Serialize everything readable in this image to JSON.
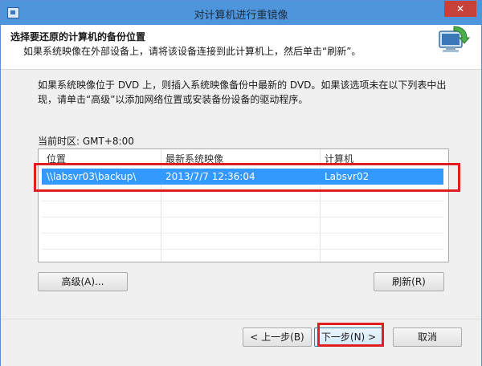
{
  "window": {
    "title": "对计算机进行重镜像",
    "close_glyph": "✕"
  },
  "header": {
    "title": "选择要还原的计算机的备份位置",
    "subtitle": "如果系统映像在外部设备上，请将该设备连接到此计算机上，然后单击“刷新”。",
    "icon": "computer-restore-icon"
  },
  "description": "如果系统映像位于 DVD 上，则插入系统映像备份中最新的 DVD。如果该选项未在以下列表中出现，请单击“高级”以添加网络位置或安装备份设备的驱动程序。",
  "timezone": {
    "text": "当前时区: GMT+8:00"
  },
  "table": {
    "columns": [
      "位置",
      "最新系统映像",
      "计算机"
    ],
    "rows": [
      {
        "location": "\\\\labsvr03\\backup\\",
        "latest_image": "2013/7/7 12:36:04",
        "computer": "Labsvr02",
        "selected": true
      }
    ]
  },
  "buttons": {
    "advanced": "高级(A)...",
    "refresh": "刷新(R)",
    "back": "< 上一步(B)",
    "next": "下一步(N) >",
    "cancel": "取消"
  },
  "colors": {
    "titlebar": "#4f95dc",
    "selection": "#3399ff",
    "highlight": "#e02020"
  }
}
